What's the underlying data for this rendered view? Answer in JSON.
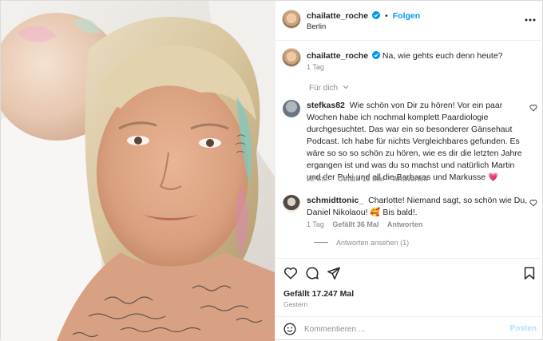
{
  "post": {
    "author": "chailatte_roche",
    "follow_label": "Folgen",
    "location": "Berlin",
    "caption": "Na, wie gehts euch denn heute?",
    "caption_time": "1 Tag",
    "for_you_label": "Für dich",
    "likes": "Gefällt 17.247 Mal",
    "date": "Gestern"
  },
  "comments": [
    {
      "username": "stefkas82",
      "text": "Wie schön von Dir zu hören! Vor ein paar Wochen habe ich nochmal komplett Paardiologie durchgesuchtet. Das war ein so besonderer Gänsehaut Podcast. Ich habe für nichts Vergleichbares gefunden. Es wäre so so so schön zu hören, wie es dir die letzten Jahre ergangen ist und was du so machst und natürlich Martin und der Puki und all die Barbaras und Markusse 💗",
      "time": "22 Std.",
      "likes": "Gefällt 10 Mal",
      "reply_label": "Antworten"
    },
    {
      "username": "schmidttonic_",
      "text": "Charlotte! Niemand sagt, so schön wie Du, Daniel Nikolaou! 🥰 Bis bald!.",
      "time": "1 Tag",
      "likes": "Gefällt 36 Mal",
      "reply_label": "Antworten",
      "view_replies": "Antworten ansehen (1)"
    }
  ],
  "comment_box": {
    "placeholder": "Kommentieren ...",
    "post_label": "Posten"
  },
  "icons": {
    "more": "more-horizontal-icon",
    "heart": "heart-icon",
    "comment": "comment-icon",
    "share": "share-icon",
    "save": "bookmark-icon",
    "emoji": "emoji-icon",
    "verified": "verified-badge-icon"
  },
  "colors": {
    "accent": "#0095f6",
    "verified": "#0095f6",
    "post_disabled": "#b2dffc",
    "muted": "#8e8e8e"
  }
}
